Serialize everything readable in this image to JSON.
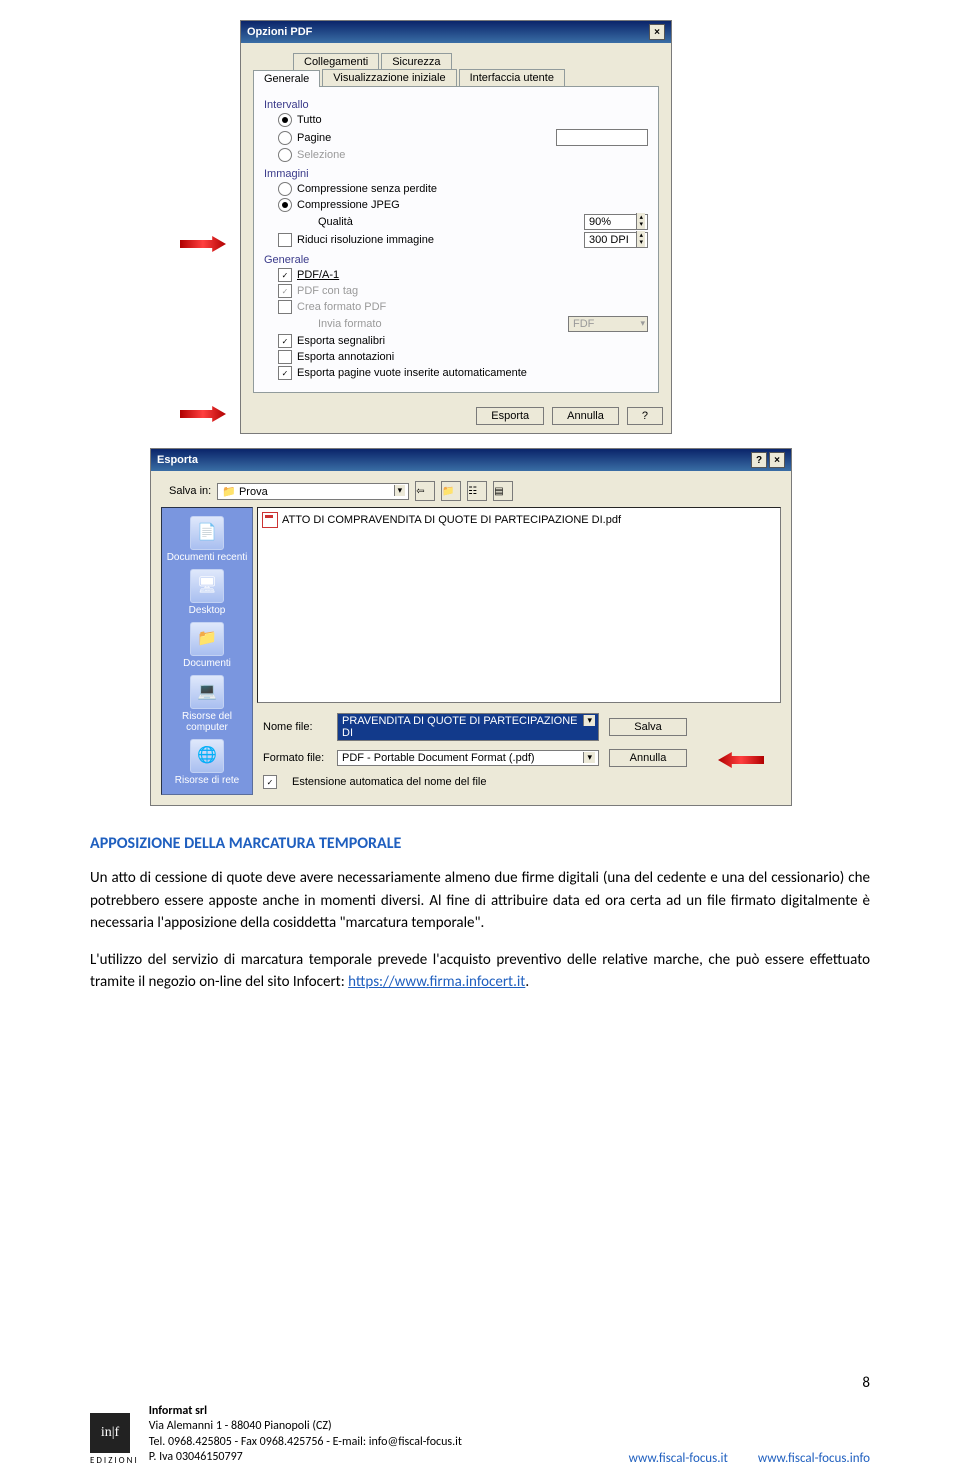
{
  "pdf_dialog": {
    "title": "Opzioni PDF",
    "tabs_back": [
      "Collegamenti",
      "Sicurezza"
    ],
    "tabs_front": [
      "Generale",
      "Visualizzazione iniziale",
      "Interfaccia utente"
    ],
    "grp_intervallo": "Intervallo",
    "opt_tutto": "Tutto",
    "opt_pagine": "Pagine",
    "opt_selezione": "Selezione",
    "grp_immagini": "Immagini",
    "opt_comp_no_loss": "Compressione senza perdite",
    "opt_comp_jpeg": "Compressione JPEG",
    "lbl_qualita": "Qualità",
    "val_qualita": "90%",
    "chk_riduci": "Riduci risoluzione immagine",
    "val_dpi": "300 DPI",
    "grp_generale": "Generale",
    "chk_pdfa": "PDF/A-1",
    "chk_pdftag": "PDF con tag",
    "chk_creaform": "Crea formato PDF",
    "lbl_inviaform": "Invia formato",
    "val_fdf": "FDF",
    "chk_segnalibri": "Esporta segnalibri",
    "chk_annot": "Esporta annotazioni",
    "chk_emptypages": "Esporta pagine vuote inserite automaticamente",
    "btn_esporta": "Esporta",
    "btn_annulla": "Annulla",
    "btn_help": "?"
  },
  "save_dialog": {
    "title": "Esporta",
    "lbl_salvain": "Salva in:",
    "folder": "Prova",
    "places": [
      "Documenti recenti",
      "Desktop",
      "Documenti",
      "Risorse del computer",
      "Risorse di rete"
    ],
    "file_listed": "ATTO DI COMPRAVENDITA DI QUOTE DI PARTECIPAZIONE DI.pdf",
    "lbl_nome": "Nome file:",
    "val_nome": "PRAVENDITA DI QUOTE DI PARTECIPAZIONE DI",
    "lbl_formato": "Formato file:",
    "val_formato": "PDF - Portable Document Format (.pdf)",
    "chk_ext_auto": "Estensione automatica del nome del file",
    "btn_salva": "Salva",
    "btn_annulla": "Annulla"
  },
  "article": {
    "heading": "APPOSIZIONE DELLA MARCATURA TEMPORALE",
    "p1": "Un atto di cessione di quote deve avere necessariamente almeno due firme digitali (una del cedente e una del cessionario) che potrebbero essere apposte anche in momenti diversi. Al fine di attribuire data ed ora certa ad un file firmato digitalmente è necessaria l'apposizione della cosiddetta \"marcatura temporale\".",
    "p2a": "L'utilizzo del servizio di marcatura temporale prevede l'acquisto preventivo delle relative marche, che può essere effettuato tramite il negozio on-line del sito Infocert: ",
    "link": "https://www.firma.infocert.it",
    "p2b": "."
  },
  "footer": {
    "brand": "in|f",
    "edizioni": "EDIZIONI",
    "company": "Informat srl",
    "addr": "Via Alemanni 1 - 88040 Pianopoli (CZ)",
    "tel": "Tel. 0968.425805 - Fax 0968.425756 - E-mail: info@fiscal-focus.it",
    "piva": "P. Iva 03046150797",
    "site1": "www.fiscal-focus.it",
    "site2": "www.fiscal-focus.info",
    "page": "8"
  }
}
